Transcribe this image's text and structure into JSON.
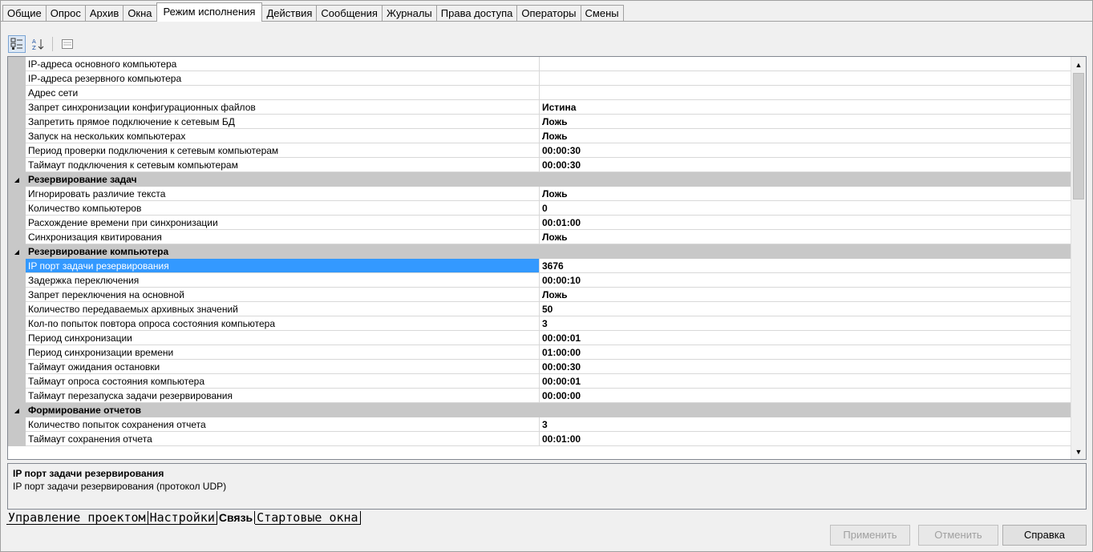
{
  "tabs": [
    "Общие",
    "Опрос",
    "Архив",
    "Окна",
    "Режим исполнения",
    "Действия",
    "Сообщения",
    "Журналы",
    "Права доступа",
    "Операторы",
    "Смены"
  ],
  "toolbar": {
    "categorized_icon": "categorized-view-icon",
    "alphabetical_icon": "alphabetical-sort-icon",
    "pages_icon": "property-pages-icon"
  },
  "grid": {
    "rows": [
      {
        "type": "prop",
        "name": "IP-адреса основного компьютера",
        "value": ""
      },
      {
        "type": "prop",
        "name": "IP-адреса резервного компьютера",
        "value": ""
      },
      {
        "type": "prop",
        "name": "Адрес сети",
        "value": ""
      },
      {
        "type": "prop",
        "name": "Запрет синхронизации конфигурационных файлов",
        "value": "Истина"
      },
      {
        "type": "prop",
        "name": "Запретить прямое подключение к сетевым БД",
        "value": "Ложь"
      },
      {
        "type": "prop",
        "name": "Запуск на нескольких компьютерах",
        "value": "Ложь"
      },
      {
        "type": "prop",
        "name": "Период проверки подключения к сетевым компьютерам",
        "value": "00:00:30"
      },
      {
        "type": "prop",
        "name": "Таймаут подключения к сетевым компьютерам",
        "value": "00:00:30"
      },
      {
        "type": "cat",
        "name": "Резервирование задач"
      },
      {
        "type": "prop",
        "name": "Игнорировать различие текста",
        "value": "Ложь"
      },
      {
        "type": "prop",
        "name": "Количество компьютеров",
        "value": "0"
      },
      {
        "type": "prop",
        "name": "Расхождение времени при синхронизации",
        "value": "00:01:00"
      },
      {
        "type": "prop",
        "name": "Синхронизация квитирования",
        "value": "Ложь"
      },
      {
        "type": "cat",
        "name": "Резервирование компьютера"
      },
      {
        "type": "prop",
        "name": "IP порт задачи резервирования",
        "value": "3676",
        "selected": true
      },
      {
        "type": "prop",
        "name": "Задержка переключения",
        "value": "00:00:10"
      },
      {
        "type": "prop",
        "name": "Запрет переключения на основной",
        "value": "Ложь"
      },
      {
        "type": "prop",
        "name": "Количество передаваемых архивных значений",
        "value": "50"
      },
      {
        "type": "prop",
        "name": "Кол-по попыток повтора опроса состояния компьютера",
        "value": "3"
      },
      {
        "type": "prop",
        "name": "Период синхронизации",
        "value": "00:00:01"
      },
      {
        "type": "prop",
        "name": "Период синхронизации времени",
        "value": "01:00:00"
      },
      {
        "type": "prop",
        "name": "Таймаут ожидания остановки",
        "value": "00:00:30"
      },
      {
        "type": "prop",
        "name": "Таймаут опроса состояния компьютера",
        "value": "00:00:01"
      },
      {
        "type": "prop",
        "name": "Таймаут перезапуска задачи резервирования",
        "value": "00:00:00"
      },
      {
        "type": "cat",
        "name": "Формирование отчетов"
      },
      {
        "type": "prop",
        "name": "Количество попыток сохранения отчета",
        "value": "3"
      },
      {
        "type": "prop",
        "name": "Таймаут сохранения отчета",
        "value": "00:01:00"
      }
    ]
  },
  "description": {
    "title": "IP порт задачи резервирования",
    "text": "IP порт задачи резервирования (протокол UDP)"
  },
  "bottom_tabs": [
    "Управление проектом",
    "Настройки",
    "Связь",
    "Стартовые окна"
  ],
  "bottom_active": "Связь",
  "buttons": {
    "apply": "Применить",
    "cancel": "Отменить",
    "help": "Справка"
  }
}
